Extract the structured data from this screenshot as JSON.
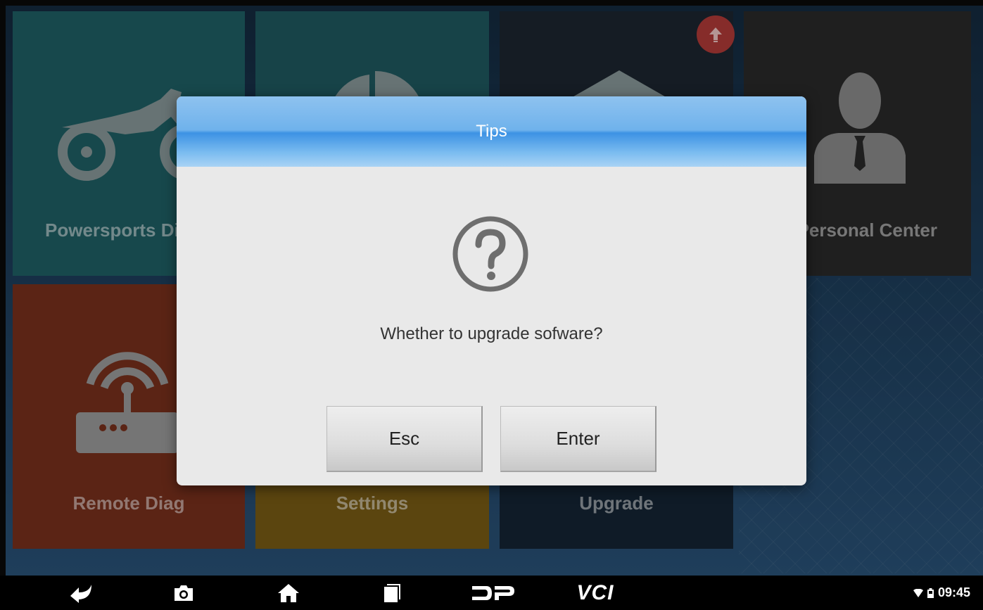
{
  "tiles": {
    "powersports": "Powersports Diag",
    "personal": "Personal Center",
    "remote": "Remote Diag",
    "settings": "Settings",
    "upgrade": "Upgrade"
  },
  "dialog": {
    "title": "Tips",
    "message": "Whether to upgrade sofware?",
    "esc_label": "Esc",
    "enter_label": "Enter"
  },
  "navbar": {
    "vci_label": "VCI",
    "time": "09:45"
  },
  "icons": {
    "back": "back-icon",
    "camera": "camera-icon",
    "home": "home-icon",
    "recent": "recent-apps-icon",
    "dp": "dp-logo-icon",
    "wifi": "wifi-icon",
    "battery": "battery-icon",
    "question": "question-icon",
    "upgrade_badge": "upgrade-arrow-icon"
  },
  "colors": {
    "dialog_header": "#5aa6ea",
    "tile_powersports": "#1f6166",
    "tile_remote": "#7a301c",
    "tile_settings": "#7a5d15",
    "badge": "#b33b38"
  }
}
